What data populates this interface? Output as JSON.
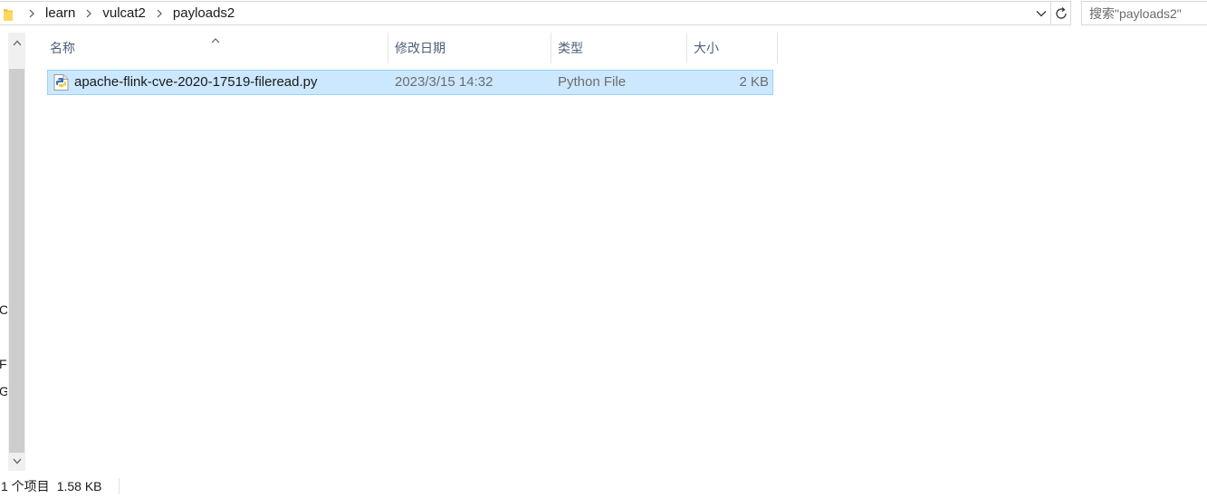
{
  "address_bar": {
    "breadcrumbs": [
      "learn",
      "vulcat2",
      "payloads2"
    ]
  },
  "search": {
    "placeholder": "搜索\"payloads2\""
  },
  "columns": {
    "name": "名称",
    "date_modified": "修改日期",
    "type": "类型",
    "size": "大小"
  },
  "files": [
    {
      "name": "apache-flink-cve-2020-17519-fileread.py",
      "date_modified": "2023/3/15 14:32",
      "type": "Python File",
      "size": "2 KB",
      "selected": true,
      "icon": "python-file-icon"
    }
  ],
  "side_clipped_letters": [
    "C",
    "F",
    "G"
  ],
  "status": {
    "item_count": "1 个项目",
    "selection_size": "1.58 KB"
  },
  "colors": {
    "selection_bg": "#cce8ff",
    "selection_border": "#99d1ff",
    "header_text": "#4c607a",
    "scrollbar_thumb": "#cdcdcd"
  }
}
